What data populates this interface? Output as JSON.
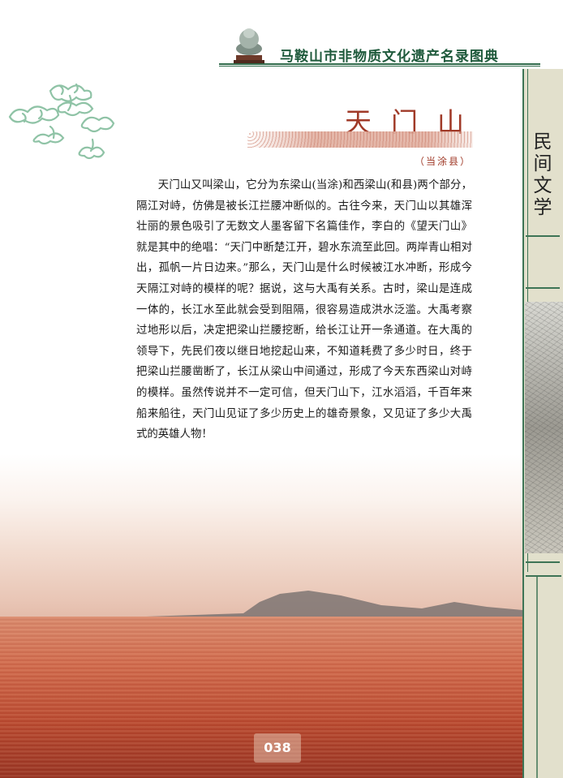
{
  "header": {
    "title": "马鞍山市非物质文化遗产名录图典"
  },
  "sidebar": {
    "category": [
      "民",
      "间",
      "文",
      "学"
    ]
  },
  "article": {
    "title": "天门山",
    "location": "（当涂县）",
    "body": "天门山又叫梁山，它分为东梁山(当涂)和西梁山(和县)两个部分，隔江对峙，仿佛是被长江拦腰冲断似的。古往今来，天门山以其雄浑壮丽的景色吸引了无数文人墨客留下名篇佳作，李白的《望天门山》就是其中的绝唱：“天门中断楚江开，碧水东流至此回。两岸青山相对出，孤帆一片日边来。”那么，天门山是什么时候被江水冲断，形成今天隔江对峙的模样的呢？据说，这与大禹有关系。古时，梁山是连成一体的，长江水至此就会受到阻隔，很容易造成洪水泛滥。大禹考察过地形以后，决定把梁山拦腰挖断，给长江让开一条通道。在大禹的领导下，先民们夜以继日地挖起山来，不知道耗费了多少时日，终于把梁山拦腰凿断了，长江从梁山中间通过，形成了今天东西梁山对峙的模样。虽然传说并不一定可信，但天门山下，江水滔滔，千百年来船来船往，天门山见证了多少历史上的雄奇景象，又见证了多少大禹式的英雄人物！"
  },
  "page": {
    "number": "038"
  },
  "colors": {
    "header_green": "#1f5a3c",
    "title_red": "#a03a28",
    "sidebar_bg": "#e2e0cc"
  }
}
